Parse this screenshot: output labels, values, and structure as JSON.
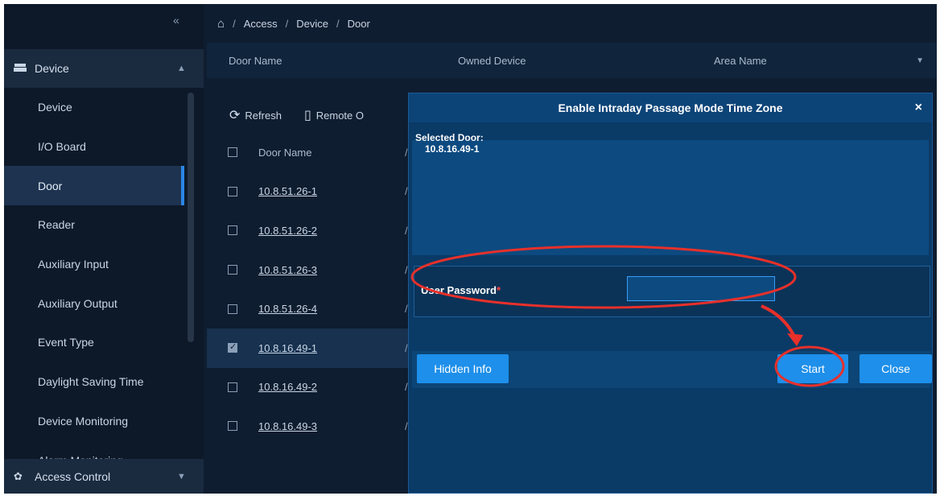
{
  "sidebar": {
    "collapse_label": "«",
    "device_group": {
      "label": "Device",
      "icon": "device-icon"
    },
    "items": [
      {
        "label": "Device"
      },
      {
        "label": "I/O Board"
      },
      {
        "label": "Door"
      },
      {
        "label": "Reader"
      },
      {
        "label": "Auxiliary Input"
      },
      {
        "label": "Auxiliary Output"
      },
      {
        "label": "Event Type"
      },
      {
        "label": "Daylight Saving Time"
      },
      {
        "label": "Device Monitoring"
      },
      {
        "label": "Alarm Monitoring"
      }
    ],
    "active_item": "Door",
    "access_group": {
      "label": "Access Control",
      "icon": "gear-icon"
    }
  },
  "breadcrumb": {
    "items": [
      "Access",
      "Device",
      "Door"
    ],
    "separator": "/"
  },
  "filters": {
    "door_name": "Door Name",
    "owned_device": "Owned Device",
    "area_name": "Area Name"
  },
  "toolbar": {
    "refresh": "Refresh",
    "remote": "Remote O"
  },
  "table": {
    "header": "Door Name",
    "rows": [
      {
        "name": "10.8.51.26-1",
        "checked": false
      },
      {
        "name": "10.8.51.26-2",
        "checked": false
      },
      {
        "name": "10.8.51.26-3",
        "checked": false
      },
      {
        "name": "10.8.51.26-4",
        "checked": false
      },
      {
        "name": "10.8.16.49-1",
        "checked": true
      },
      {
        "name": "10.8.16.49-2",
        "checked": false
      },
      {
        "name": "10.8.16.49-3",
        "checked": false
      }
    ]
  },
  "modal": {
    "title": "Enable Intraday Passage Mode Time Zone",
    "close_x": "×",
    "selected_label": "Selected Door:",
    "selected_value": "10.8.16.49-1",
    "password_label": "User Password",
    "required_mark": "*",
    "password_value": "",
    "buttons": {
      "hidden_info": "Hidden Info",
      "start": "Start",
      "close": "Close"
    }
  },
  "colors": {
    "accent": "#1e8fea",
    "annotation": "#e8302a",
    "background": "#0f1d30"
  }
}
